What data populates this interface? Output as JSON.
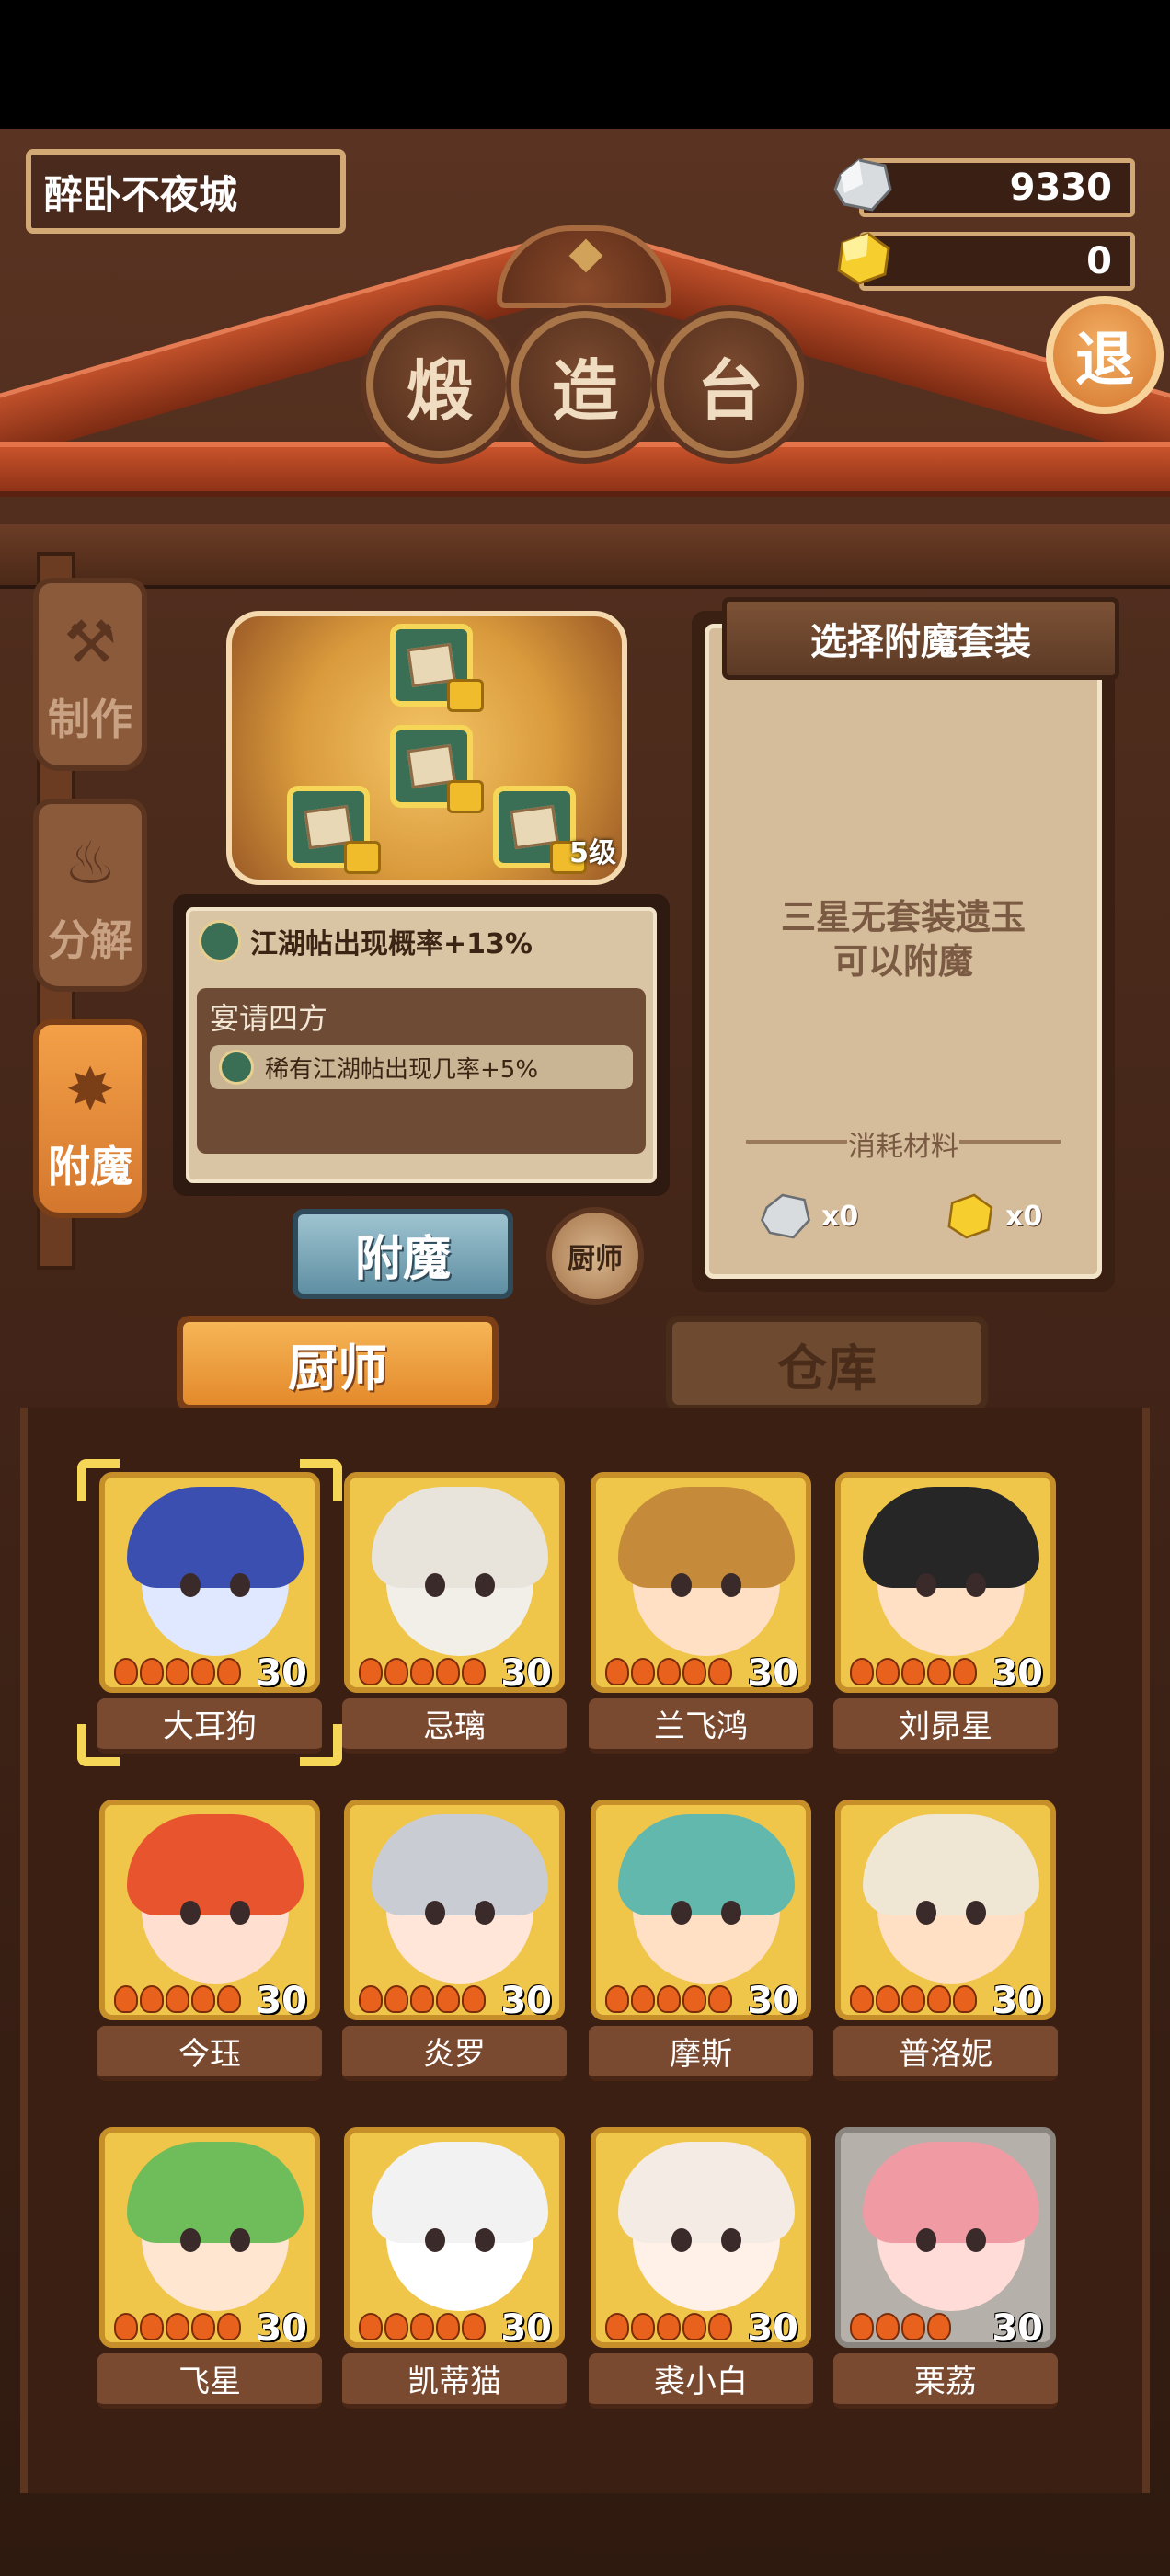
{
  "header": {
    "city_name": "醉卧不夜城",
    "stone_count": "9330",
    "gold_count": "0",
    "title_chars": [
      "煅",
      "造",
      "台"
    ],
    "exit_label": "退"
  },
  "side_tabs": [
    {
      "label": "制作",
      "icon": "hammer-icon"
    },
    {
      "label": "分解",
      "icon": "flame-icon"
    },
    {
      "label": "附魔",
      "icon": "swirl-icon",
      "active": true
    }
  ],
  "altar": {
    "level_text": "5级"
  },
  "info": {
    "bonus_text": "江湖帖出现概率+13%",
    "set_name": "宴请四方",
    "set_bonus": "稀有江湖帖出现几率+5%"
  },
  "buttons": {
    "enchant": "附魔",
    "chef_small": "厨师"
  },
  "right_panel": {
    "header": "选择附魔套装",
    "message_line1": "三星无套装遗玉",
    "message_line2": "可以附魔",
    "consume_label": "消耗材料",
    "stone_qty": "x0",
    "gold_qty": "x0"
  },
  "bottom_tabs": {
    "chef": "厨师",
    "warehouse": "仓库"
  },
  "chefs": [
    {
      "name": "大耳狗",
      "level": "30",
      "selected": true
    },
    {
      "name": "忌璃",
      "level": "30"
    },
    {
      "name": "兰飞鸿",
      "level": "30"
    },
    {
      "name": "刘昴星",
      "level": "30"
    },
    {
      "name": "今珏",
      "level": "30"
    },
    {
      "name": "炎罗",
      "level": "30"
    },
    {
      "name": "摩斯",
      "level": "30"
    },
    {
      "name": "普洛妮",
      "level": "30"
    },
    {
      "name": "飞星",
      "level": "30"
    },
    {
      "name": "凯蒂猫",
      "level": "30"
    },
    {
      "name": "裘小白",
      "level": "30"
    },
    {
      "name": "栗荔",
      "level": "30"
    }
  ],
  "colors": {
    "accent_orange": "#e38a2c",
    "wood_dark": "#3b1f13",
    "gold_frame": "#f0c64a"
  }
}
